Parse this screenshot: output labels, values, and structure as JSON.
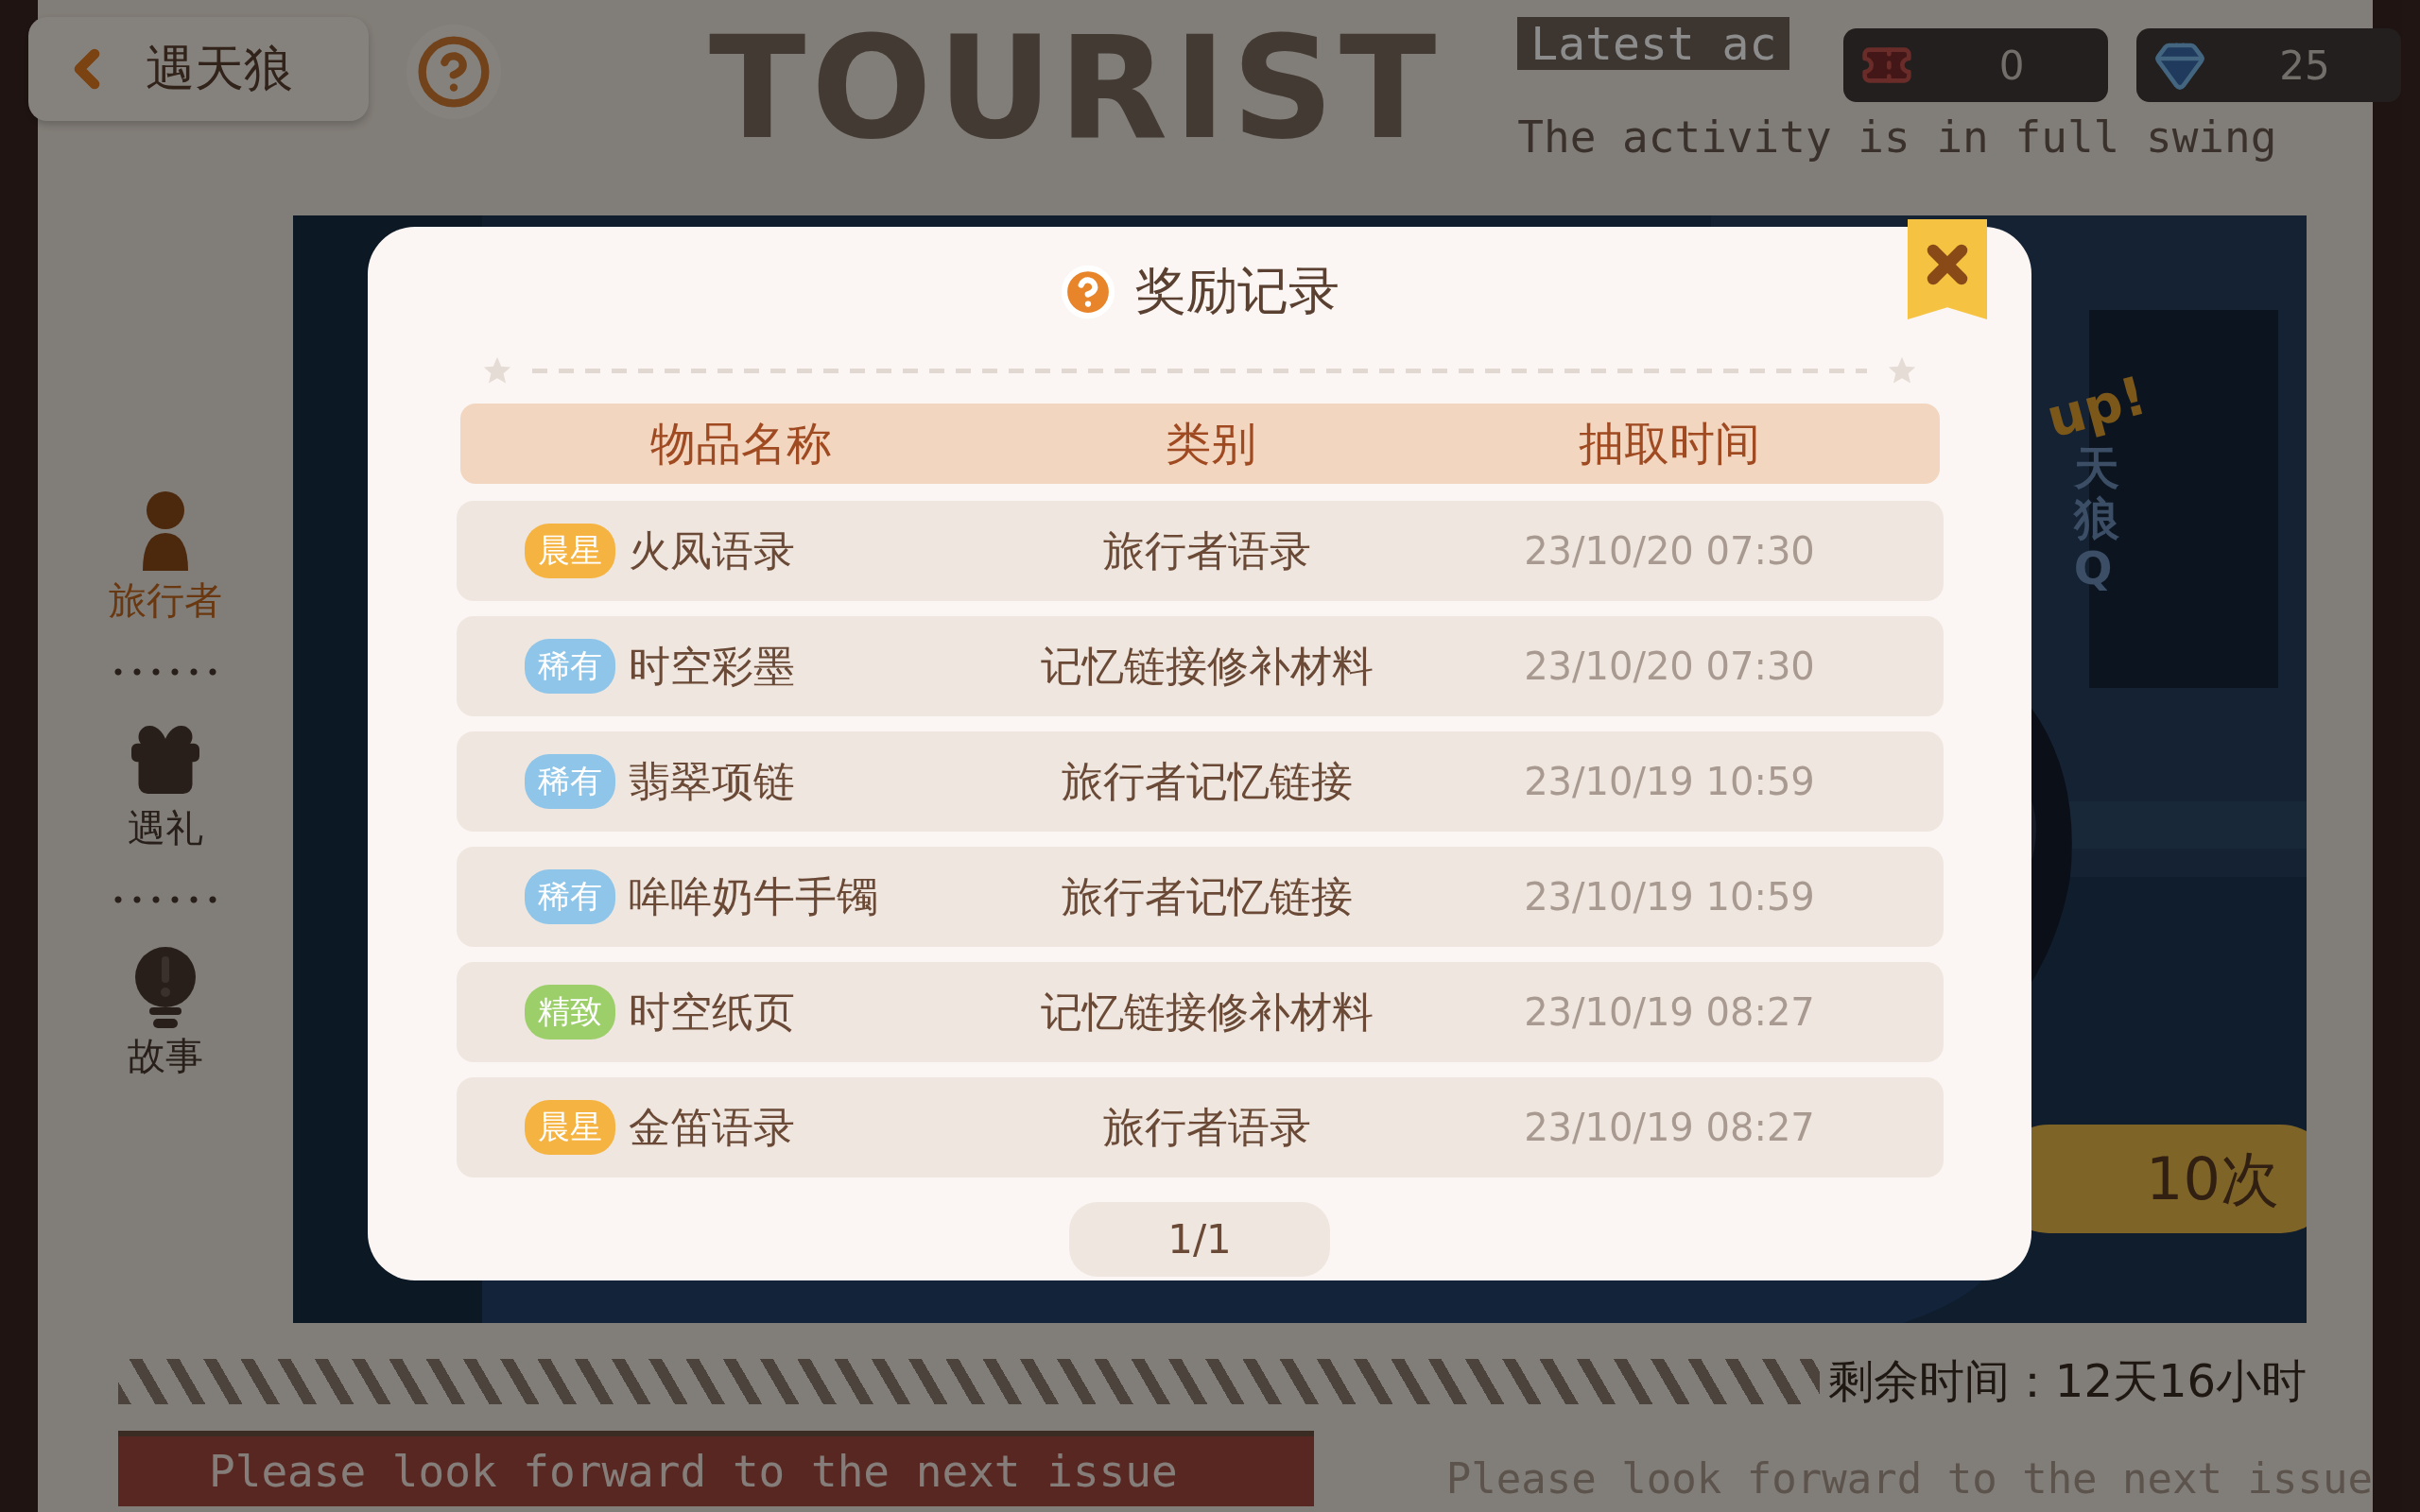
{
  "top_bar": {
    "back_button": {
      "label": "遇天狼"
    },
    "title": "TOURIST",
    "notice": {
      "heading": "Latest ac",
      "subtitle": "The activity is in full swing"
    },
    "currencies": [
      {
        "kind": "ticket",
        "amount": "0"
      },
      {
        "kind": "crystal",
        "amount": "25"
      }
    ]
  },
  "sidebar": {
    "items": [
      {
        "kind": "traveler",
        "label": "旅行者",
        "selected": true
      },
      {
        "kind": "gift",
        "label": "遇礼",
        "selected": false
      },
      {
        "kind": "story",
        "label": "故事",
        "selected": false
      }
    ]
  },
  "banner": {
    "tag": "up!",
    "name": "天狼Q",
    "draw_button": {
      "label": "10次"
    }
  },
  "footer": {
    "remaining_time": "剩余时间：12天16小时",
    "notices": [
      "Please look forward to the next issue",
      "Please look forward to the next issue"
    ]
  },
  "dialog": {
    "title": "奖励记录",
    "columns": [
      "物品名称",
      "类别",
      "抽取时间"
    ],
    "rows": [
      {
        "rarity": "晨星",
        "color": "#f5b342",
        "name": "火凤语录",
        "category": "旅行者语录",
        "time": "23/10/20 07:30"
      },
      {
        "rarity": "稀有",
        "color": "#8ec5e8",
        "name": "时空彩墨",
        "category": "记忆链接修补材料",
        "time": "23/10/20 07:30"
      },
      {
        "rarity": "稀有",
        "color": "#8ec5e8",
        "name": "翡翠项链",
        "category": "旅行者记忆链接",
        "time": "23/10/19 10:59"
      },
      {
        "rarity": "稀有",
        "color": "#8ec5e8",
        "name": "哞哞奶牛手镯",
        "category": "旅行者记忆链接",
        "time": "23/10/19 10:59"
      },
      {
        "rarity": "精致",
        "color": "#9ccf6a",
        "name": "时空纸页",
        "category": "记忆链接修补材料",
        "time": "23/10/19 08:27"
      },
      {
        "rarity": "晨星",
        "color": "#f5b342",
        "name": "金笛语录",
        "category": "旅行者语录",
        "time": "23/10/19 08:27"
      }
    ],
    "page": "1/1"
  }
}
